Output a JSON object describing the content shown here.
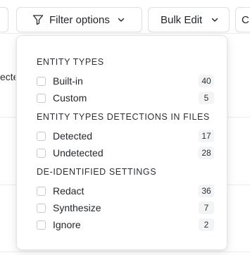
{
  "toolbar": {
    "filter_label": "Filter options",
    "bulk_edit_label": "Bulk Edit",
    "right_stub_text": "C"
  },
  "background": {
    "cell_fragment": "ecte"
  },
  "filter_menu": {
    "sections": [
      {
        "header": "ENTITY TYPES",
        "options": [
          {
            "label": "Built-in",
            "count": "40"
          },
          {
            "label": "Custom",
            "count": "5"
          }
        ]
      },
      {
        "header": "ENTITY TYPES DETECTIONS IN FILES",
        "options": [
          {
            "label": "Detected",
            "count": "17"
          },
          {
            "label": "Undetected",
            "count": "28"
          }
        ]
      },
      {
        "header": "DE-IDENTIFIED SETTINGS",
        "options": [
          {
            "label": "Redact",
            "count": "36"
          },
          {
            "label": "Synthesize",
            "count": "7"
          },
          {
            "label": "Ignore",
            "count": "2"
          }
        ]
      }
    ]
  },
  "icons": {
    "filter": "funnel-icon",
    "chevron": "chevron-down-icon"
  }
}
